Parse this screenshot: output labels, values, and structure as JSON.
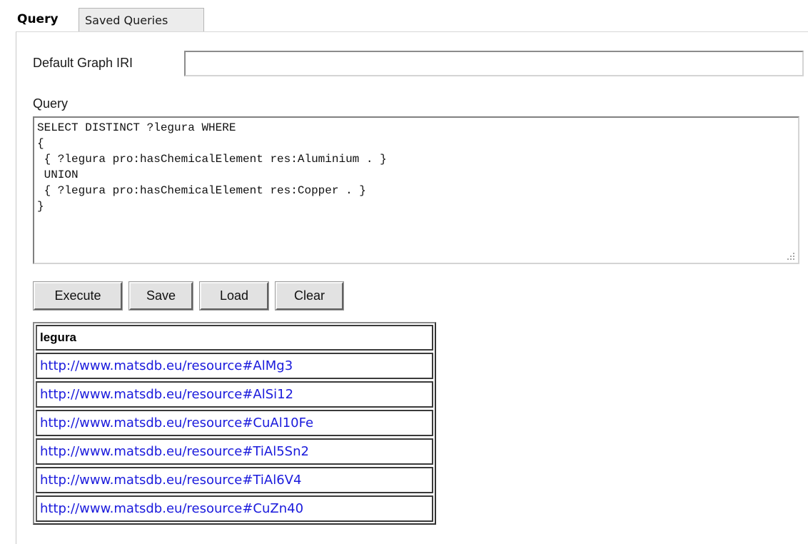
{
  "tabs": [
    {
      "label": "Query",
      "active": true
    },
    {
      "label": "Saved Queries",
      "active": false
    }
  ],
  "form": {
    "default_graph_label": "Default Graph IRI",
    "default_graph_value": "",
    "query_label": "Query",
    "query_text": "SELECT DISTINCT ?legura WHERE\n{\n { ?legura pro:hasChemicalElement res:Aluminium . }\n UNION\n { ?legura pro:hasChemicalElement res:Copper . }\n}"
  },
  "buttons": {
    "execute": "Execute",
    "save": "Save",
    "load": "Load",
    "clear": "Clear"
  },
  "results": {
    "column": "legura",
    "rows": [
      "http://www.matsdb.eu/resource#AlMg3",
      "http://www.matsdb.eu/resource#AlSi12",
      "http://www.matsdb.eu/resource#CuAl10Fe",
      "http://www.matsdb.eu/resource#TiAl5Sn2",
      "http://www.matsdb.eu/resource#TiAl6V4",
      "http://www.matsdb.eu/resource#CuZn40"
    ]
  },
  "colors": {
    "link": "#1a1adc",
    "button_face": "#e2e2e2",
    "inactive_tab": "#ececec"
  }
}
